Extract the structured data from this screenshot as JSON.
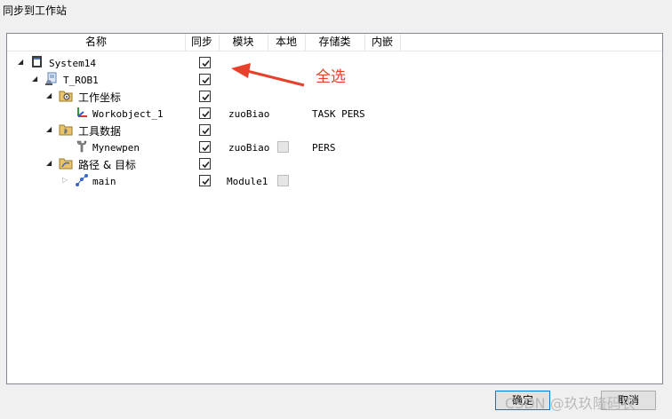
{
  "window": {
    "title": "同步到工作站"
  },
  "columns": [
    "名称",
    "同步",
    "模块",
    "本地",
    "存储类",
    "内嵌"
  ],
  "tree": [
    {
      "label": "System14",
      "icon": "controller-icon",
      "expander": "open",
      "sync": true
    },
    {
      "label": "T_ROB1",
      "icon": "robot-task-icon",
      "expander": "open",
      "sync": true
    },
    {
      "label": "工作坐标",
      "icon": "workobject-folder-icon",
      "expander": "open",
      "sync": true
    },
    {
      "label": "Workobject_1",
      "icon": "coordinate-frame-icon",
      "sync": true,
      "module": "zuoBiao",
      "storage": "TASK PERS"
    },
    {
      "label": "工具数据",
      "icon": "tooldata-folder-icon",
      "expander": "open",
      "sync": true
    },
    {
      "label": "Mynewpen",
      "icon": "tool-icon",
      "sync": true,
      "module": "zuoBiao",
      "local": false,
      "storage": "PERS"
    },
    {
      "label": "路径 & 目标",
      "icon": "paths-folder-icon",
      "expander": "open",
      "sync": true
    },
    {
      "label": "main",
      "icon": "path-icon",
      "expander": "closed",
      "sync": true,
      "module": "Module1",
      "local": false
    }
  ],
  "annotation": {
    "text": "全选",
    "color": "#e8412b"
  },
  "buttons": {
    "ok": "确定",
    "cancel": "取消"
  },
  "watermark": "CSDN @玖玖隆码农"
}
